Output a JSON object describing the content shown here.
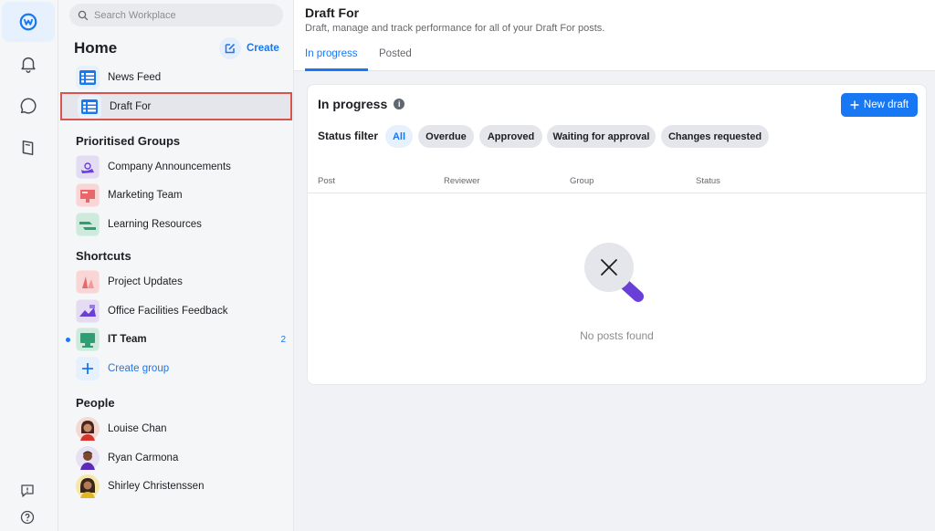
{
  "search": {
    "placeholder": "Search Workplace"
  },
  "sidebar": {
    "title": "Home",
    "create_label": "Create",
    "top_items": [
      {
        "label": "News Feed",
        "icon": "news-feed-icon"
      },
      {
        "label": "Draft For",
        "icon": "draft-icon",
        "selected": true
      }
    ],
    "groups_header": "Prioritised Groups",
    "groups": [
      {
        "label": "Company Announcements"
      },
      {
        "label": "Marketing Team"
      },
      {
        "label": "Learning Resources"
      }
    ],
    "shortcuts_header": "Shortcuts",
    "shortcuts": [
      {
        "label": "Project Updates"
      },
      {
        "label": "Office Facilities Feedback"
      },
      {
        "label": "IT Team",
        "count": "2",
        "unread": true
      }
    ],
    "create_group_label": "Create group",
    "people_header": "People",
    "people": [
      {
        "label": "Louise Chan"
      },
      {
        "label": "Ryan Carmona"
      },
      {
        "label": "Shirley Christenssen"
      }
    ]
  },
  "main": {
    "title": "Draft For",
    "subtitle": "Draft, manage and track performance for all of your Draft For posts.",
    "tabs": [
      {
        "label": "In progress",
        "active": true
      },
      {
        "label": "Posted",
        "active": false
      }
    ],
    "card": {
      "title": "In progress",
      "new_draft_label": "New draft",
      "status_filter_label": "Status filter",
      "filters": [
        {
          "label": "All",
          "active": true
        },
        {
          "label": "Overdue"
        },
        {
          "label": "Approved"
        },
        {
          "label": "Waiting for approval"
        },
        {
          "label": "Changes requested"
        }
      ],
      "columns": [
        "Post",
        "Reviewer",
        "Group",
        "Status"
      ],
      "empty_text": "No posts found"
    }
  },
  "colors": {
    "accent": "#1877f2",
    "selection_border": "#d9534f",
    "empty_handle": "#6a3fd8"
  }
}
